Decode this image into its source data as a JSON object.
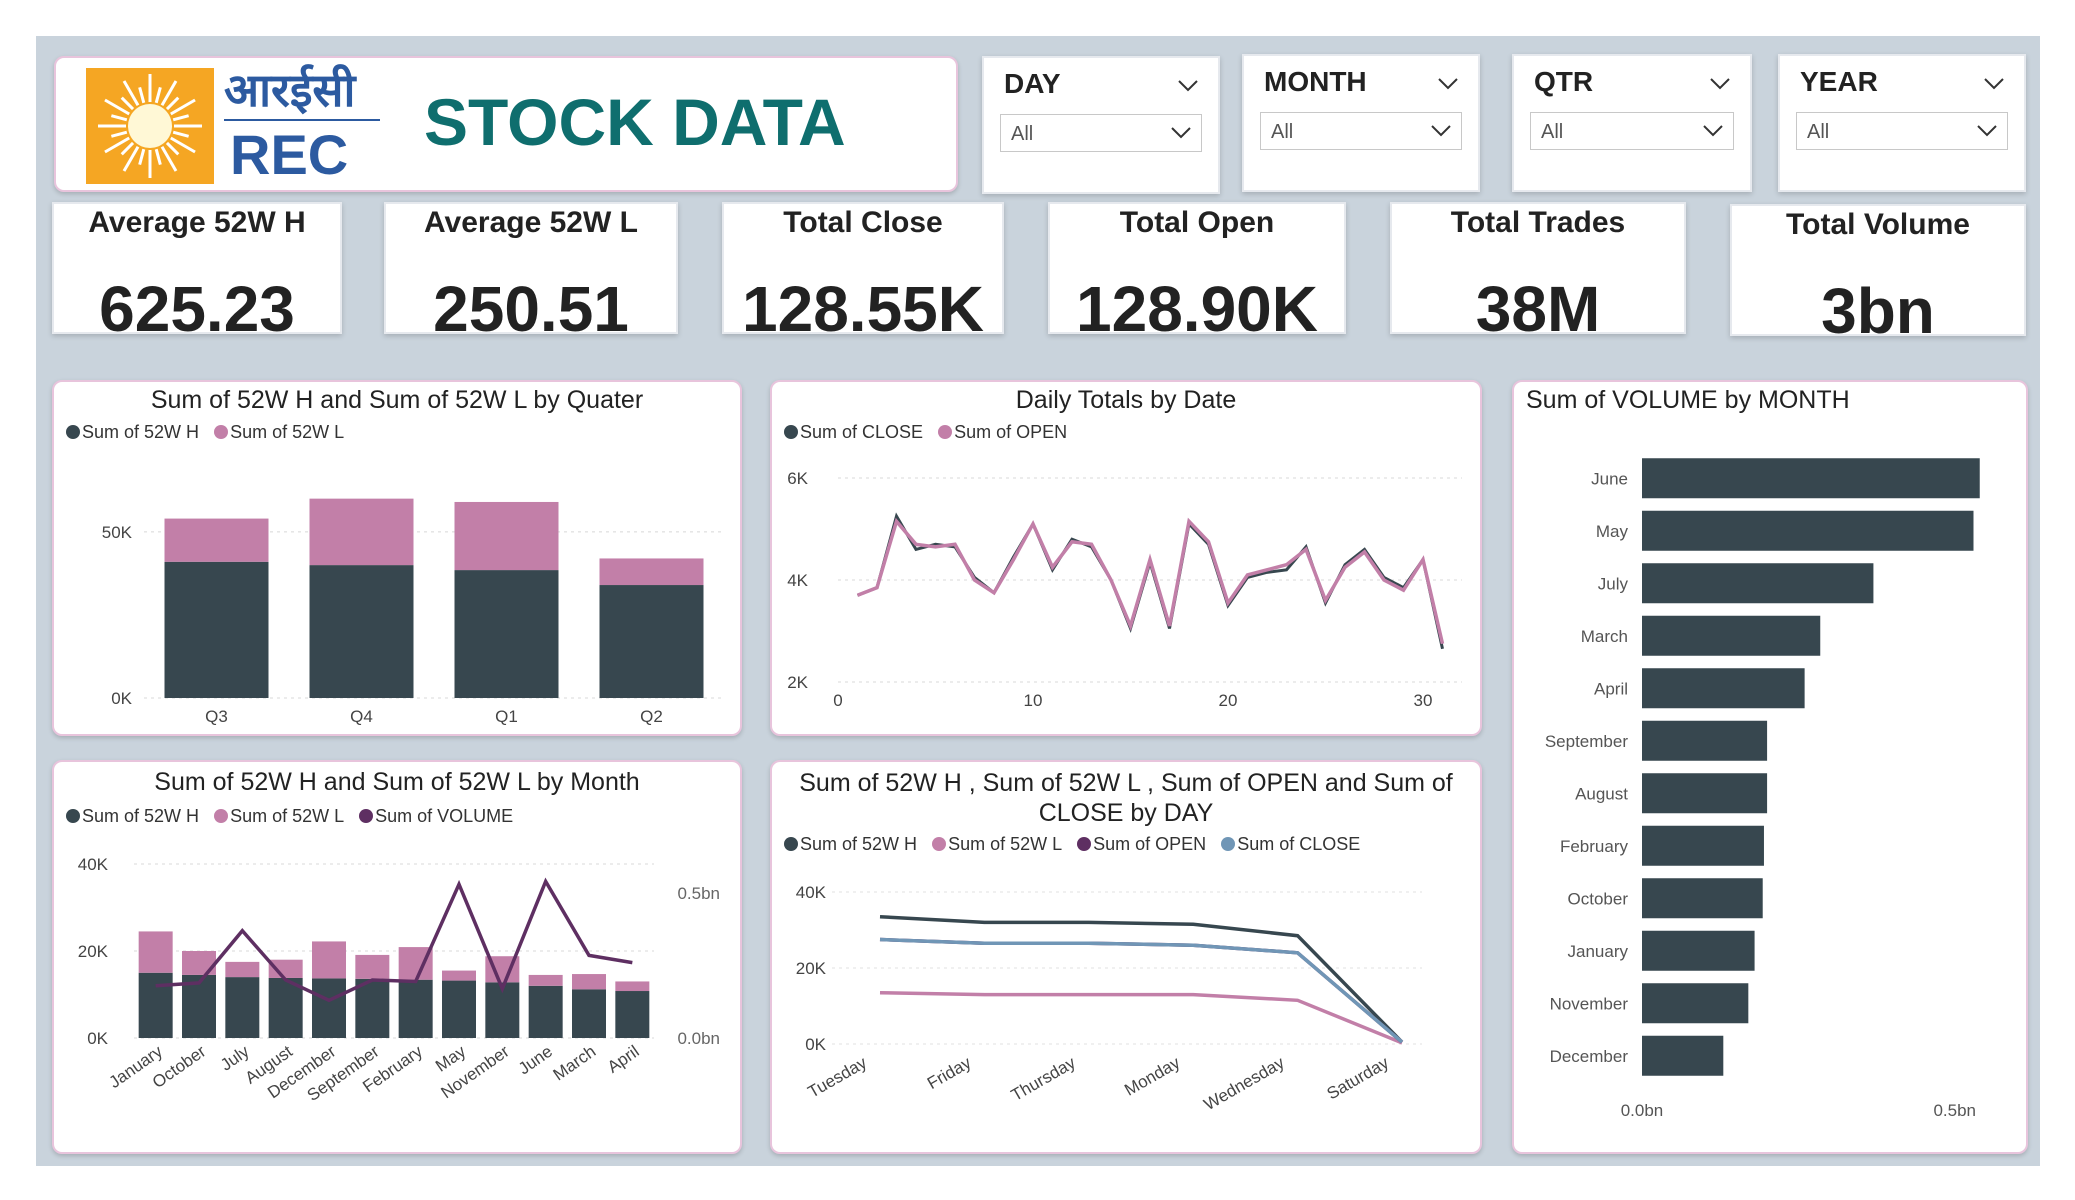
{
  "header": {
    "logo_text_hindi": "आरईसी",
    "logo_text": "REC",
    "title": "STOCK DATA"
  },
  "slicers": [
    {
      "label": "DAY",
      "value": "All"
    },
    {
      "label": "MONTH",
      "value": "All"
    },
    {
      "label": "QTR",
      "value": "All"
    },
    {
      "label": "YEAR",
      "value": "All"
    }
  ],
  "kpis": [
    {
      "label": "Average 52W H",
      "value": "625.23"
    },
    {
      "label": "Average 52W L",
      "value": "250.51"
    },
    {
      "label": "Total Close",
      "value": "128.55K"
    },
    {
      "label": "Total Open",
      "value": "128.90K"
    },
    {
      "label": "Total Trades",
      "value": "38M"
    },
    {
      "label": "Total Volume",
      "value": "3bn"
    }
  ],
  "colors": {
    "dark": "#37474f",
    "pink": "#c27fa8",
    "purple": "#5e2f62",
    "blue": "#7096b6",
    "orange": "#f5a623"
  },
  "chart_data": [
    {
      "id": "quarter",
      "type": "bar",
      "title": "Sum of 52W H and Sum of 52W L by Quater",
      "stacked": true,
      "categories": [
        "Q3",
        "Q4",
        "Q1",
        "Q2"
      ],
      "series": [
        {
          "name": "Sum of 52W H",
          "values": [
            41000,
            40000,
            38500,
            34000
          ]
        },
        {
          "name": "Sum of 52W L",
          "values": [
            13000,
            20000,
            20500,
            8000
          ]
        }
      ],
      "yticks": [
        "0K",
        "50K"
      ],
      "ylim": [
        0,
        62000
      ]
    },
    {
      "id": "daily",
      "type": "line",
      "title": "Daily Totals by Date",
      "x": [
        1,
        2,
        3,
        4,
        5,
        6,
        7,
        8,
        9,
        10,
        11,
        12,
        13,
        14,
        15,
        16,
        17,
        18,
        19,
        20,
        21,
        22,
        23,
        24,
        25,
        26,
        27,
        28,
        29,
        30,
        31
      ],
      "series": [
        {
          "name": "Sum of CLOSE",
          "values": [
            3700,
            3850,
            5250,
            4600,
            4700,
            4650,
            4050,
            3750,
            4450,
            5100,
            4200,
            4800,
            4650,
            4000,
            3050,
            4350,
            3050,
            5100,
            4700,
            3500,
            4050,
            4150,
            4200,
            4650,
            3550,
            4300,
            4600,
            4050,
            3850,
            4400,
            2650
          ]
        },
        {
          "name": "Sum of OPEN",
          "values": [
            3700,
            3850,
            5150,
            4700,
            4650,
            4700,
            4000,
            3750,
            4400,
            5100,
            4250,
            4750,
            4700,
            4000,
            3100,
            4400,
            3100,
            5150,
            4750,
            3550,
            4100,
            4200,
            4300,
            4600,
            3600,
            4250,
            4550,
            4000,
            3800,
            4400,
            2750
          ]
        }
      ],
      "xticks": [
        0,
        10,
        20,
        30
      ],
      "yticks": [
        "2K",
        "4K",
        "6K"
      ],
      "xlim": [
        0,
        32
      ],
      "ylim": [
        2000,
        6000
      ]
    },
    {
      "id": "volume_month",
      "type": "bar",
      "orientation": "horizontal",
      "title": "Sum of VOLUME by MONTH",
      "categories": [
        "June",
        "May",
        "July",
        "March",
        "April",
        "September",
        "August",
        "February",
        "October",
        "January",
        "November",
        "December"
      ],
      "series": [
        {
          "name": "Sum of VOLUME",
          "values": [
            0.54,
            0.53,
            0.37,
            0.285,
            0.26,
            0.2,
            0.2,
            0.195,
            0.193,
            0.18,
            0.17,
            0.13
          ]
        }
      ],
      "xticks": [
        "0.0bn",
        "0.5bn"
      ],
      "xlim": [
        0,
        0.55
      ]
    },
    {
      "id": "month_combo",
      "type": "bar",
      "title": "Sum of 52W H and Sum of 52W L by Month",
      "stacked": true,
      "categories": [
        "January",
        "October",
        "July",
        "August",
        "December",
        "September",
        "February",
        "May",
        "November",
        "June",
        "March",
        "April"
      ],
      "series": [
        {
          "name": "Sum of 52W H",
          "values": [
            15000,
            14500,
            14000,
            13800,
            13700,
            13600,
            13400,
            13200,
            12800,
            12000,
            11200,
            10800
          ]
        },
        {
          "name": "Sum of 52W L",
          "values": [
            9500,
            5500,
            3500,
            4200,
            8500,
            5500,
            7500,
            2300,
            6000,
            2500,
            3500,
            2200
          ]
        },
        {
          "name": "Sum of VOLUME",
          "axis": "secondary",
          "values": [
            0.18,
            0.19,
            0.37,
            0.2,
            0.13,
            0.2,
            0.195,
            0.53,
            0.17,
            0.54,
            0.285,
            0.26
          ]
        }
      ],
      "yticks": [
        "0K",
        "20K",
        "40K"
      ],
      "y2ticks": [
        "0.0bn",
        "0.5bn"
      ],
      "ylim": [
        0,
        40000
      ],
      "y2lim": [
        0,
        0.6
      ]
    },
    {
      "id": "by_day",
      "type": "line",
      "title": "Sum of 52W H , Sum of 52W L , Sum of OPEN and Sum of CLOSE by DAY",
      "categories": [
        "Tuesday",
        "Friday",
        "Thursday",
        "Monday",
        "Wednesday",
        "Saturday"
      ],
      "series": [
        {
          "name": "Sum of 52W H",
          "values": [
            33500,
            32000,
            32000,
            31500,
            28500,
            500
          ]
        },
        {
          "name": "Sum of 52W L",
          "values": [
            13500,
            13000,
            13000,
            13000,
            11500,
            300
          ]
        },
        {
          "name": "Sum of OPEN",
          "values": [
            27500,
            26500,
            26500,
            26000,
            24000,
            500
          ]
        },
        {
          "name": "Sum of CLOSE",
          "values": [
            27500,
            26500,
            26500,
            26000,
            24000,
            500
          ]
        }
      ],
      "yticks": [
        "0K",
        "20K",
        "40K"
      ],
      "ylim": [
        0,
        40000
      ]
    }
  ]
}
